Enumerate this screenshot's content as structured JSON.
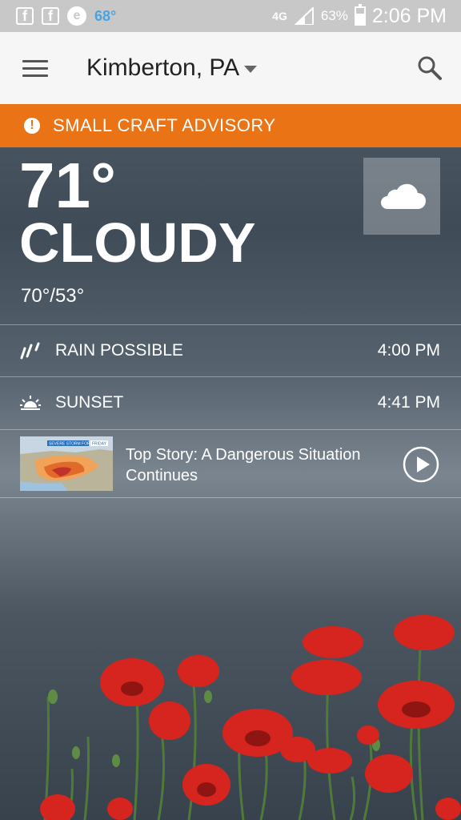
{
  "status_bar": {
    "app_icons": [
      "facebook-icon",
      "facebook-icon",
      "e-icon"
    ],
    "weather_temp": "68°",
    "network": "4G",
    "battery": "63%",
    "time": "2:06 PM",
    "temp_color": "#4aa3e0"
  },
  "header": {
    "location": "Kimberton, PA",
    "background": "#f6f6f6"
  },
  "advisory": {
    "text": "SMALL CRAFT ADVISORY",
    "color": "#ea7315"
  },
  "current": {
    "temperature": "71°",
    "condition": "CLOUDY",
    "hi_lo": "70°/53°",
    "condition_icon": "cloud-icon"
  },
  "details": [
    {
      "icon": "rain-icon",
      "label": "RAIN POSSIBLE",
      "value": "4:00 PM"
    },
    {
      "icon": "sunset-icon",
      "label": "SUNSET",
      "value": "4:41 PM"
    }
  ],
  "top_story": {
    "title": "Top Story: A Dangerous Situation Continues",
    "thumbnail_banner": "SEVERE STORM FORECAST",
    "thumbnail_tag": "FRIDAY",
    "icon": "play-icon"
  }
}
